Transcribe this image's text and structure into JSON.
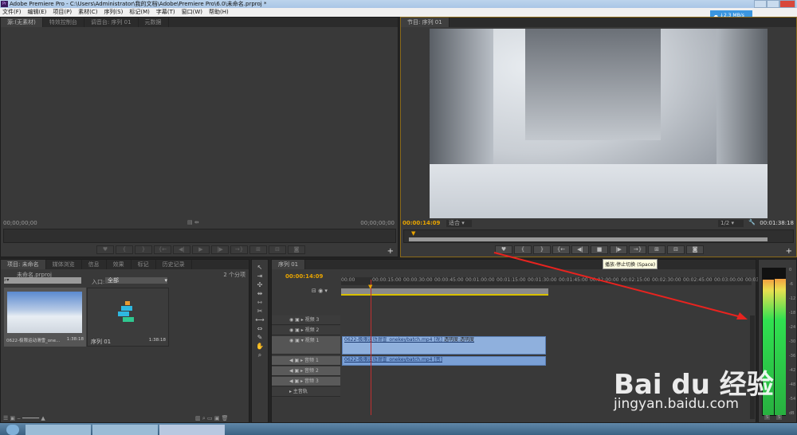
{
  "window": {
    "title": "Adobe Premiere Pro - C:\\Users\\Administrator\\我的文档\\Adobe\\Premiere Pro\\6.0\\未命名.prproj *",
    "logo": "Pr"
  },
  "menu": [
    "文件(F)",
    "编辑(E)",
    "项目(P)",
    "素材(C)",
    "序列(S)",
    "标记(M)",
    "字幕(T)",
    "窗口(W)",
    "帮助(H)"
  ],
  "net_widget": {
    "speed": "2.3 MB/s"
  },
  "source_panel": {
    "tabs": [
      "源:(无素材)",
      "特效控制台",
      "调音台: 序列 01",
      "元数据"
    ],
    "tc_left": "00;00;00;00",
    "tc_right": "00;00;00;00"
  },
  "program_panel": {
    "tab": "节目: 序列 01",
    "tc_current": "00:00:14:09",
    "fit": "适合",
    "quality": "1/2",
    "tc_duration": "00:01:38:18"
  },
  "transport_buttons": [
    "♥",
    "{",
    "}",
    "{←",
    "◀|",
    "■",
    "|▶",
    "→}",
    "⊞",
    "⊟",
    "◙"
  ],
  "source_transport": [
    "♥",
    "{",
    "}",
    "{←",
    "◀|",
    "▶",
    "|▶",
    "→}",
    "⊞",
    "⊟",
    "◙"
  ],
  "tooltip": "播放-停止切换 (Space)",
  "project_panel": {
    "tabs": [
      "项目: 未命名",
      "媒体浏览",
      "信息",
      "效果",
      "标记",
      "历史记录"
    ],
    "file": "未命名.prproj",
    "count": "2 个分项",
    "in_label": "入口:",
    "in_value": "全部",
    "items": [
      {
        "name": "0622-极限运动滑雪_one...",
        "duration": "1:38:18"
      },
      {
        "name": "序列 01",
        "duration": "1:38:18"
      }
    ]
  },
  "timeline": {
    "tab": "序列 01",
    "tc": "00:00:14:09",
    "ruler": [
      "00:00",
      "00:00:15:00",
      "00:00:30:00",
      "00:00:45:00",
      "00:01:00:00",
      "00:01:15:00",
      "00:01:30:00",
      "00:01:45:00",
      "00:02:00:00",
      "00:02:15:00",
      "00:02:30:00",
      "00:02:45:00",
      "00:03:00:00",
      "00:03:1"
    ],
    "tracks": [
      "视频 3",
      "视频 2",
      "视频 1",
      "音频 1",
      "音频 2",
      "音频 3",
      "主音轨"
    ],
    "video_clip": "0622-极限运动滑雪_onekeybatch.mp4 [视]",
    "opacity": "透明度:透明度",
    "audio_clip": "0622-极限运动滑雪_onekeybatch.mp4 [音]"
  },
  "meter": {
    "scale": [
      "0",
      "-6",
      "-12",
      "-18",
      "-24",
      "-30",
      "-36",
      "-42",
      "-48",
      "-54",
      "dB"
    ],
    "solo": [
      "S",
      "S"
    ]
  },
  "watermark": {
    "brand": "Bai du 经验",
    "url": "jingyan.baidu.com"
  },
  "colors": {
    "accent": "#e8a400",
    "clip": "#8fb0dd",
    "arrow": "#e8231f"
  }
}
